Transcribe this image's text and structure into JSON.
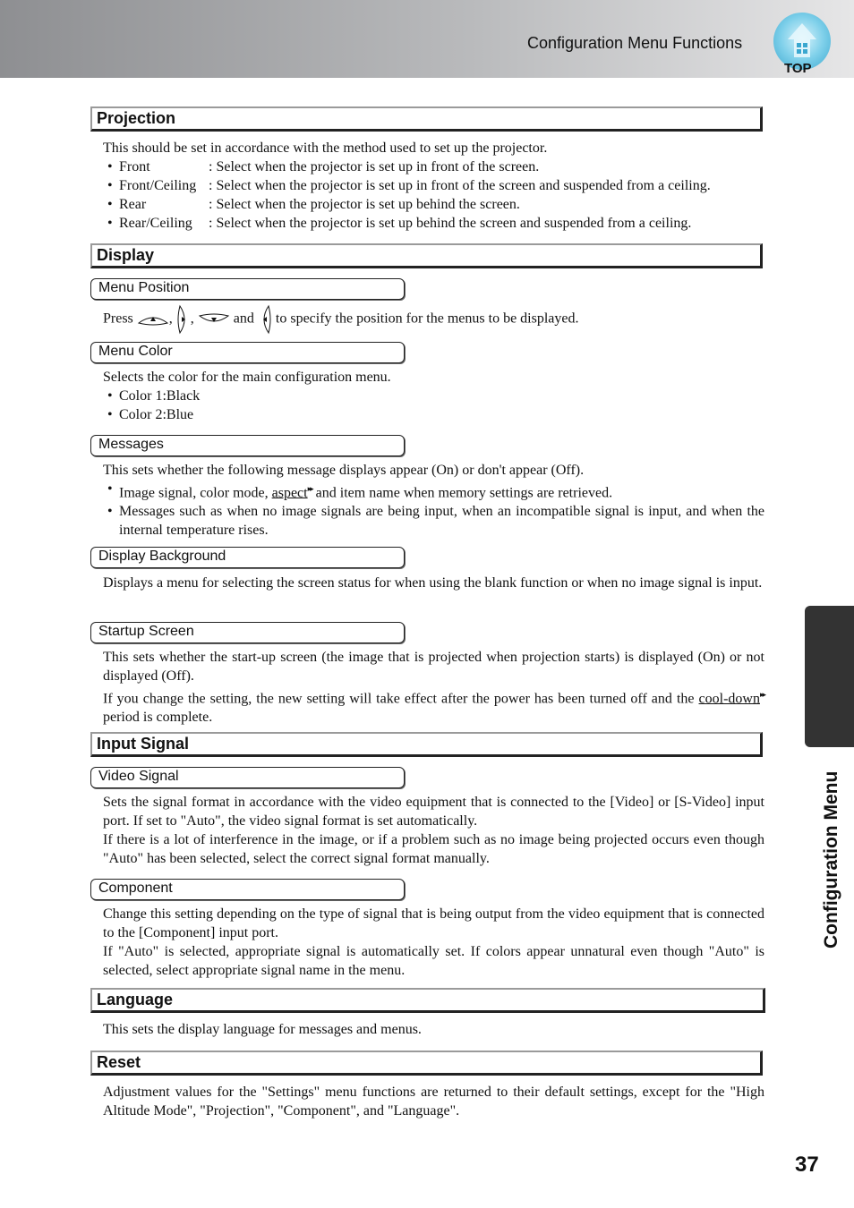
{
  "header": {
    "title": "Configuration Menu Functions",
    "top_button_label": "TOP",
    "top_button_icon": "home-icon"
  },
  "side_tab": {
    "label": "Configuration Menu"
  },
  "page_number": "37",
  "sections": {
    "projection": {
      "title": "Projection",
      "intro": "This should be set in accordance with the method used to set up the projector.",
      "options": [
        {
          "name": "Front",
          "desc": ": Select when the projector is set up in front of the screen."
        },
        {
          "name": "Front/Ceiling",
          "desc": ": Select when the projector is set up in front of the screen and suspended from a ceiling."
        },
        {
          "name": "Rear",
          "desc": ": Select when the projector is set up behind the screen."
        },
        {
          "name": "Rear/Ceiling",
          "desc": ": Select when the projector is set up behind the screen and suspended from a ceiling."
        }
      ]
    },
    "display": {
      "title": "Display",
      "menu_position": {
        "title": "Menu Position",
        "press": "Press",
        "sep1": ",",
        "sep2": ",",
        "and": "and",
        "rest": "to specify the position for the menus to be displayed.",
        "key_icons": [
          "up-arrow-key-icon",
          "right-arrow-key-icon",
          "down-arrow-key-icon",
          "left-arrow-key-icon"
        ]
      },
      "menu_color": {
        "title": "Menu Color",
        "intro": "Selects the color for the main configuration menu.",
        "items": [
          "Color 1:Black",
          "Color 2:Blue"
        ]
      },
      "messages": {
        "title": "Messages",
        "intro": "This sets whether the following message displays appear (On) or don't appear (Off).",
        "item1_pre": "Image signal, color mode, ",
        "item1_link": "aspect",
        "item1_post": " and item name when memory settings are retrieved.",
        "item2": "Messages such as when no image signals are being input, when an incompatible signal is input, and when the internal temperature rises."
      },
      "display_background": {
        "title": "Display Background",
        "text": "Displays a menu for selecting the screen status for when using the blank function or when no image signal is input."
      },
      "startup_screen": {
        "title": "Startup Screen",
        "text1": "This sets whether the start-up screen (the image that is projected when projection starts) is displayed (On) or not displayed (Off).",
        "text2_pre": "If you change the setting, the new setting will take effect after the power has been turned off and the ",
        "text2_link": "cool-down",
        "text2_post": " period is complete."
      }
    },
    "input_signal": {
      "title": "Input Signal",
      "video_signal": {
        "title": "Video Signal",
        "text1": "Sets the signal format in accordance with the video equipment that is connected to the [Video] or [S-Video] input port. If set to \"Auto\", the video signal format is set automatically.",
        "text2": "If there is a lot of interference in the image, or if a problem such as no image being projected occurs even though \"Auto\" has been selected, select the correct signal format manually."
      },
      "component": {
        "title": "Component",
        "text1": "Change this setting depending on the type of signal that is being output from the video equipment that is connected to the [Component] input port.",
        "text2": "If \"Auto\" is selected, appropriate signal is automatically set. If colors appear unnatural even though \"Auto\" is selected, select appropriate signal name in the menu."
      }
    },
    "language": {
      "title": "Language",
      "text": "This sets the display language for messages and menus."
    },
    "reset": {
      "title": "Reset",
      "text": "Adjustment values for the \"Settings\" menu functions are returned to their default settings, except for the \"High Altitude Mode\", \"Projection\", \"Component\", and \"Language\"."
    }
  },
  "glossary_marker": "▸▸"
}
